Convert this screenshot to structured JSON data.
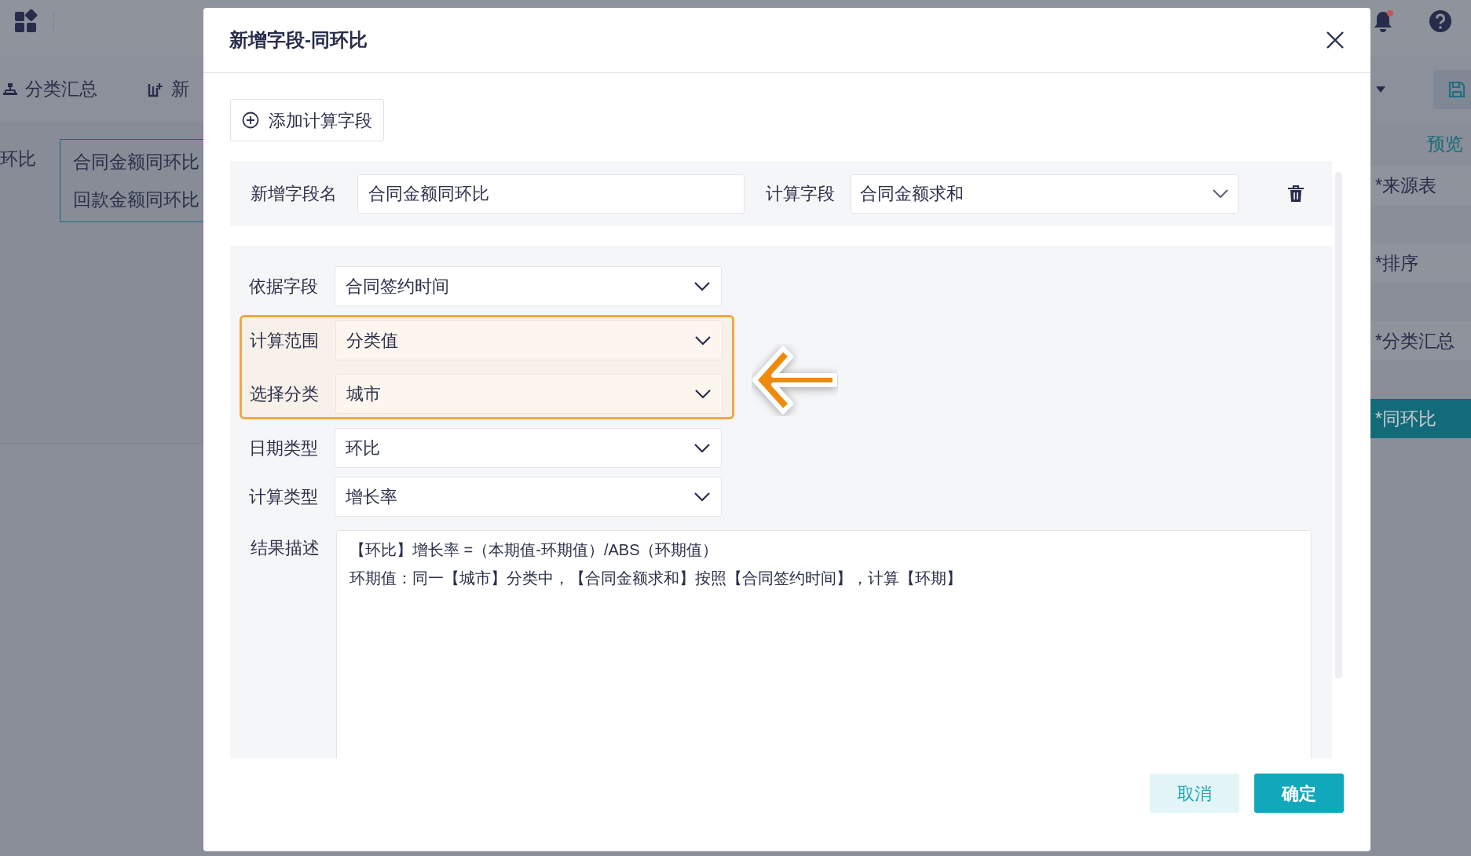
{
  "app": {
    "toolbar": [
      {
        "label": "分类汇总",
        "kind": "tree"
      },
      {
        "label": "新",
        "kind": "add-column"
      }
    ],
    "left_label": "环比",
    "field_list": [
      "合同金额同环比",
      "回款金额同环比"
    ],
    "preview": "预览",
    "steps": [
      {
        "label": "*来源表",
        "selected": false
      },
      {
        "label": "*排序",
        "selected": false
      },
      {
        "label": "*分类汇总",
        "selected": false
      },
      {
        "label": "*同环比",
        "selected": true
      }
    ],
    "notifications": {
      "unread": true
    }
  },
  "dialog": {
    "title": "新增字段-同环比",
    "add_button": "添加计算字段",
    "field_name": {
      "label": "新增字段名",
      "value": "合同金额同环比"
    },
    "calc_field": {
      "label": "计算字段",
      "value": "合同金额求和"
    },
    "settings": [
      {
        "label": "依据字段",
        "value": "合同签约时间",
        "highlighted": false
      },
      {
        "label": "计算范围",
        "value": "分类值",
        "highlighted": true
      },
      {
        "label": "选择分类",
        "value": "城市",
        "highlighted": true
      },
      {
        "label": "日期类型",
        "value": "环比",
        "highlighted": false
      },
      {
        "label": "计算类型",
        "value": "增长率",
        "highlighted": false
      }
    ],
    "result": {
      "label": "结果描述",
      "lines": [
        "【环比】增长率 =（本期值-环期值）/ABS（环期值）",
        "环期值：同一【城市】分类中，【合同金额求和】按照【合同签约时间】，计算【环期】"
      ]
    },
    "buttons": {
      "cancel": "取消",
      "confirm": "确定"
    }
  }
}
